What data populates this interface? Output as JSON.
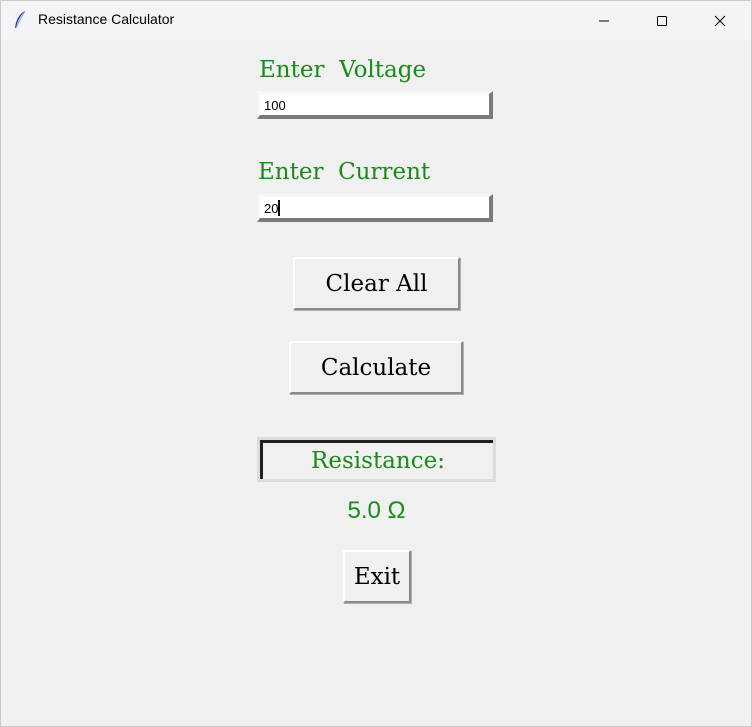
{
  "window": {
    "title": "Resistance Calculator",
    "icon": "feather-icon"
  },
  "form": {
    "voltage_label": "Enter  Voltage",
    "voltage_value": "100",
    "current_label": "Enter  Current",
    "current_value": "20"
  },
  "buttons": {
    "clear_all": "Clear All",
    "calculate": "Calculate",
    "exit": "Exit"
  },
  "result": {
    "label": "Resistance:",
    "value": "5.0 Ω"
  },
  "colors": {
    "accent_text": "#1a8a1a",
    "background": "#f0f0f0"
  }
}
